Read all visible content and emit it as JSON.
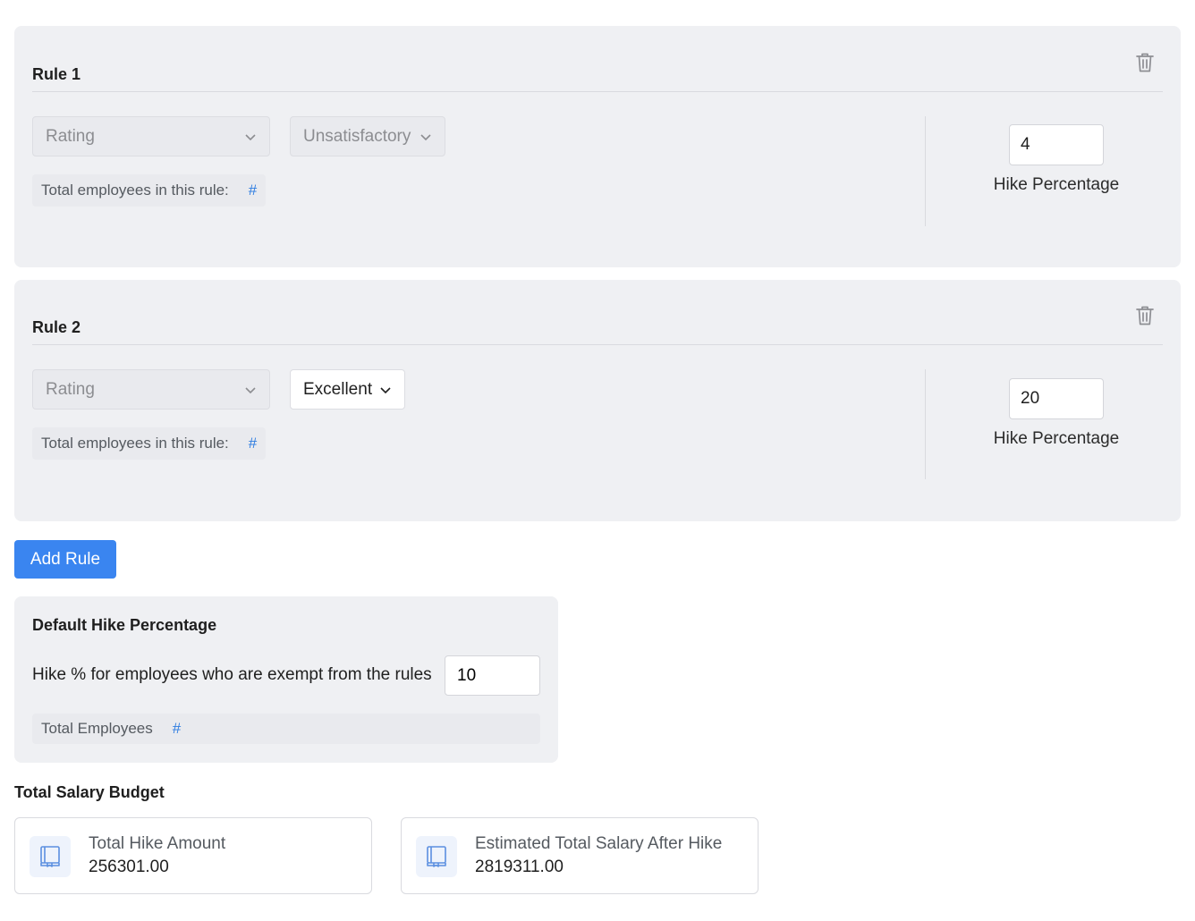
{
  "rules": [
    {
      "title": "Rule 1",
      "criteria_label": "Rating",
      "value_label": "Unsatisfactory",
      "total_label": "Total employees in this rule:",
      "total_value": "#",
      "hike_value": "4",
      "hike_label": "Hike Percentage"
    },
    {
      "title": "Rule 2",
      "criteria_label": "Rating",
      "value_label": "Excellent",
      "total_label": "Total employees in this rule:",
      "total_value": "#",
      "hike_value": "20",
      "hike_label": "Hike Percentage"
    }
  ],
  "add_rule_label": "Add Rule",
  "default_hike": {
    "title": "Default Hike Percentage",
    "exempt_label": "Hike % for employees who are exempt from the rules",
    "exempt_value": "10",
    "total_label": "Total Employees",
    "total_value": "#"
  },
  "budget": {
    "title": "Total Salary Budget",
    "cards": [
      {
        "label": "Total Hike Amount",
        "value": "256301.00",
        "icon": "ledger-icon"
      },
      {
        "label": "Estimated Total Salary After Hike",
        "value": "2819311.00",
        "icon": "ledger-icon"
      }
    ]
  },
  "colors": {
    "accent": "#3a85f0",
    "card_bg": "#eff0f3",
    "hash": "#2f7de1"
  }
}
